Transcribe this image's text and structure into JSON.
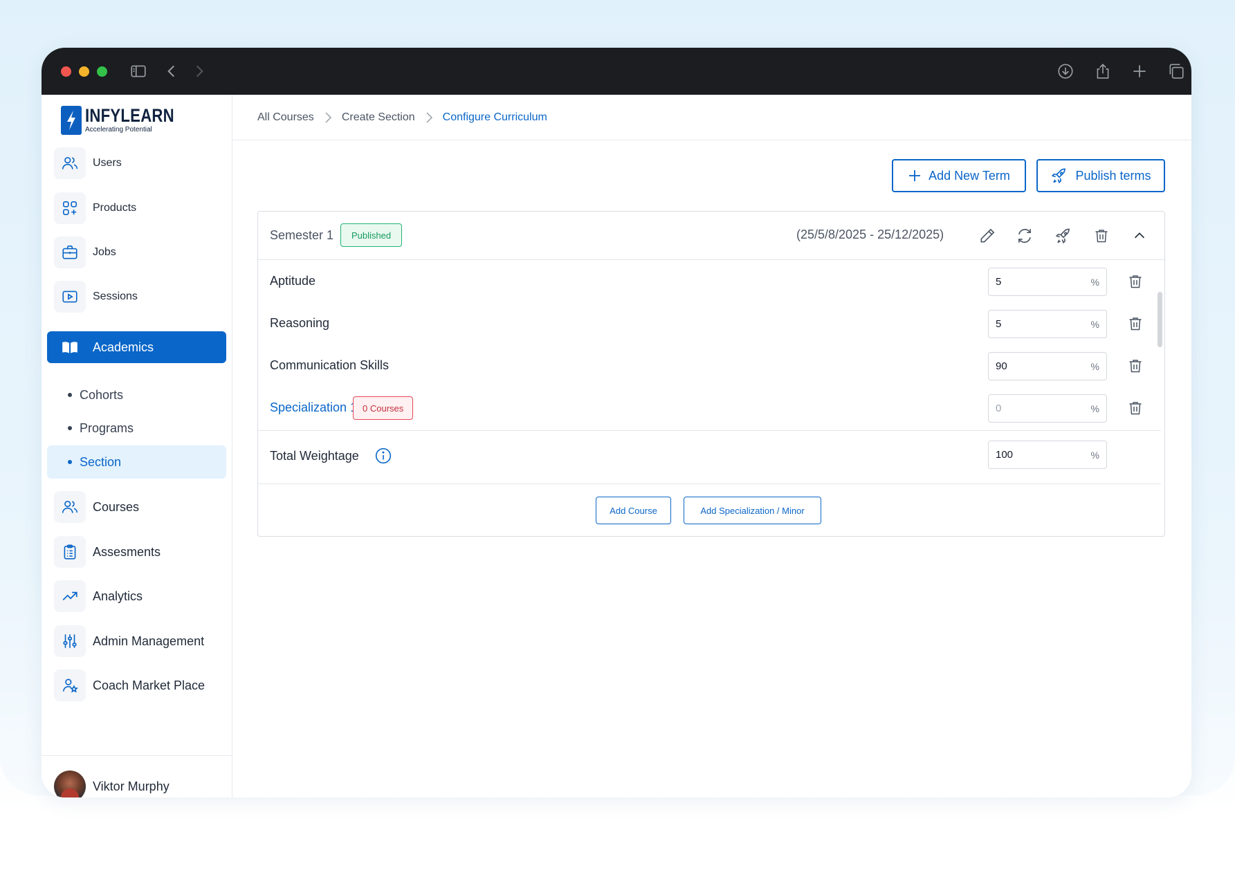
{
  "app": {
    "name": "INFYLEARN",
    "tagline": "Accelerating Potential"
  },
  "colors": {
    "accent": "#0a66c9",
    "published": "#22b573",
    "danger": "#e34b5a",
    "titlebar": "#1b1d20"
  },
  "titlebar_icons": [
    "sidebar-toggle-icon",
    "back-icon",
    "forward-icon",
    "download-icon",
    "share-icon",
    "new-tab-icon",
    "tabs-overview-icon"
  ],
  "sidebar": {
    "items": [
      {
        "label": "Users",
        "icon": "users-icon"
      },
      {
        "label": "Products",
        "icon": "grid-add-icon"
      },
      {
        "label": "Jobs",
        "icon": "briefcase-icon"
      },
      {
        "label": "Sessions",
        "icon": "play-icon"
      },
      {
        "label": "Academics",
        "icon": "book-icon",
        "active": true
      },
      {
        "label": "Courses",
        "icon": "users-icon"
      },
      {
        "label": "Assesments",
        "icon": "clipboard-icon"
      },
      {
        "label": "Analytics",
        "icon": "trend-icon"
      },
      {
        "label": "Admin Management",
        "icon": "sliders-icon"
      },
      {
        "label": "Coach Market Place",
        "icon": "user-star-icon"
      }
    ],
    "subitems": [
      {
        "label": "Cohorts"
      },
      {
        "label": "Programs"
      },
      {
        "label": "Section",
        "active": true
      }
    ],
    "user": {
      "name": "Viktor Murphy"
    }
  },
  "breadcrumb": [
    "All Courses",
    "Create Section",
    "Configure Curriculum"
  ],
  "actions": {
    "add_term": "Add New Term",
    "publish_terms": "Publish terms"
  },
  "term": {
    "title": "Semester 1",
    "status": "Published",
    "dates": "(25/5/8/2025 - 25/12/2025)",
    "header_icons": [
      "edit-icon",
      "refresh-icon",
      "rocket-icon",
      "trash-icon",
      "chevron-up-icon"
    ],
    "rows": [
      {
        "label": "Aptitude",
        "value": "5",
        "unit": "%"
      },
      {
        "label": "Reasoning",
        "value": "5",
        "unit": "%"
      },
      {
        "label": "Communication Skills",
        "value": "90",
        "unit": "%"
      },
      {
        "label": "Specialization 1",
        "badge": "0 Courses",
        "placeholder": "0",
        "unit": "%"
      }
    ],
    "total": {
      "label": "Total Weightage",
      "value": "100",
      "unit": "%"
    },
    "add_course": "Add Course",
    "add_specialization": "Add Specialization / Minor"
  }
}
